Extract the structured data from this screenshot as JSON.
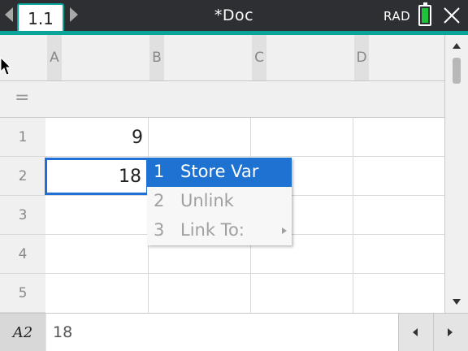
{
  "window": {
    "tab_label": "1.1",
    "doc_title": "*Doc",
    "angle_mode": "RAD"
  },
  "icons": {
    "tab_prev": "chevron-left-icon",
    "tab_next": "chevron-right-icon",
    "battery": "battery-icon",
    "close": "close-icon",
    "pointer": "mouse-pointer-icon"
  },
  "colors": {
    "accent": "#0aa39a",
    "selection": "#1f6fd6",
    "menu_highlight": "#1e73d2",
    "battery": "#1fc23b"
  },
  "spreadsheet": {
    "columns": [
      "A",
      "B",
      "C",
      "D"
    ],
    "formula_row_symbol": "=",
    "rows": [
      "1",
      "2",
      "3",
      "4",
      "5"
    ],
    "cells": {
      "A1": "9",
      "A2": "18"
    },
    "selected_cell": "A2"
  },
  "context_menu": {
    "items": [
      {
        "num": "1",
        "label": "Store Var",
        "active": true
      },
      {
        "num": "2",
        "label": "Unlink",
        "active": false
      },
      {
        "num": "3",
        "label": "Link To:",
        "active": false,
        "submenu": true
      }
    ]
  },
  "entry_line": {
    "cell_ref": "A2",
    "value": "18"
  }
}
